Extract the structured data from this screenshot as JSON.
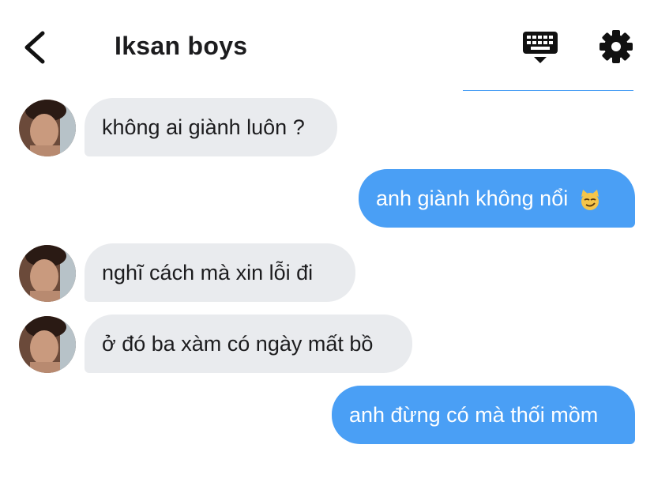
{
  "header": {
    "title": "Iksan boys",
    "icons": {
      "back": "chevron-left-icon",
      "keyboard": "keyboard-icon",
      "settings": "gear-icon"
    }
  },
  "messages": [
    {
      "side": "incoming",
      "text": "không ai giành luôn ?"
    },
    {
      "side": "outgoing",
      "text": "anh giành không nổi",
      "emoji": "smirking-cat-emoji"
    },
    {
      "side": "incoming",
      "text": "nghĩ cách mà xin lỗi đi"
    },
    {
      "side": "incoming",
      "text": "ở đó ba xàm có ngày mất bồ"
    },
    {
      "side": "outgoing",
      "text": "anh đừng có mà thối mồm"
    }
  ],
  "colors": {
    "outgoing_bubble": "#4a9ff5",
    "incoming_bubble": "#e9ebee",
    "text": "#1c1c1e"
  }
}
